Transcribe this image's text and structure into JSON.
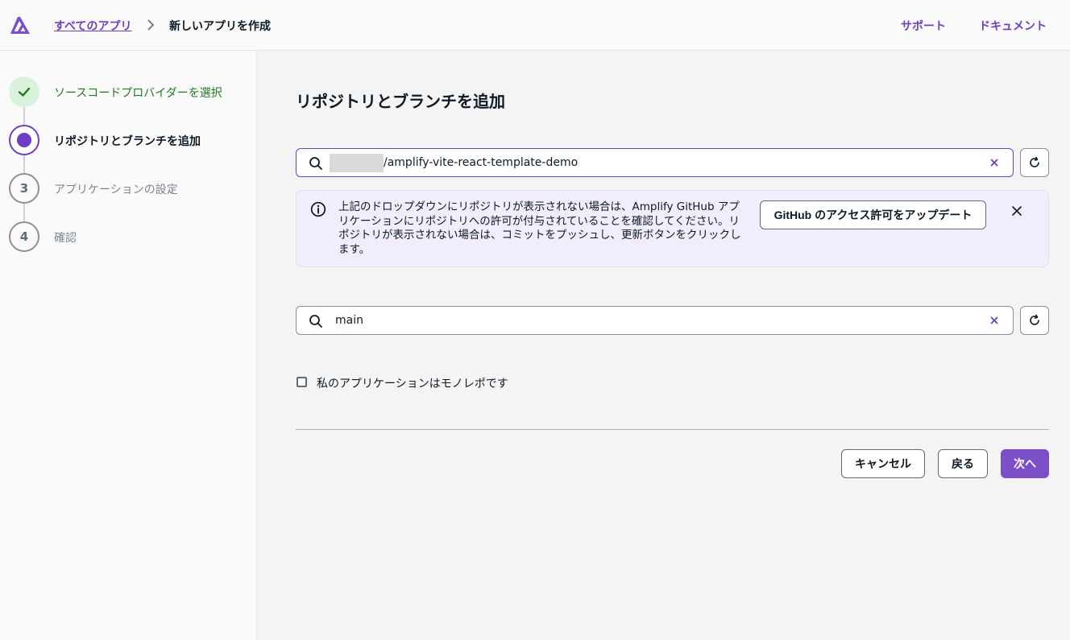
{
  "header": {
    "breadcrumb_link": "すべてのアプリ",
    "breadcrumb_current": "新しいアプリを作成",
    "nav_support": "サポート",
    "nav_docs": "ドキュメント"
  },
  "steps": [
    {
      "number": "",
      "label": "ソースコードプロバイダーを選択",
      "state": "done"
    },
    {
      "number": "",
      "label": "リポジトリとブランチを追加",
      "state": "current"
    },
    {
      "number": "3",
      "label": "アプリケーションの設定",
      "state": "todo"
    },
    {
      "number": "4",
      "label": "確認",
      "state": "todo"
    }
  ],
  "main": {
    "title": "リポジトリとブランチを追加",
    "repo_value": "/amplify-vite-react-template-demo",
    "branch_value": "main",
    "info_text": "上記のドロップダウンにリポジトリが表示されない場合は、Amplify GitHub アプリケーションにリポジトリへの許可が付与されていることを確認してください。リポジトリが表示されない場合は、コミットをプッシュし、更新ボタンをクリックします。",
    "permission_button": "GitHub のアクセス許可をアップデート",
    "monorepo_label": "私のアプリケーションはモノレポです",
    "monorepo_checked": false
  },
  "footer": {
    "cancel": "キャンセル",
    "back": "戻る",
    "next": "次へ"
  },
  "colors": {
    "accent": "#6d3fc4",
    "primary_button": "#7b4fc8",
    "done_green": "#1f7a1f",
    "info_bg": "#f1edfc"
  }
}
